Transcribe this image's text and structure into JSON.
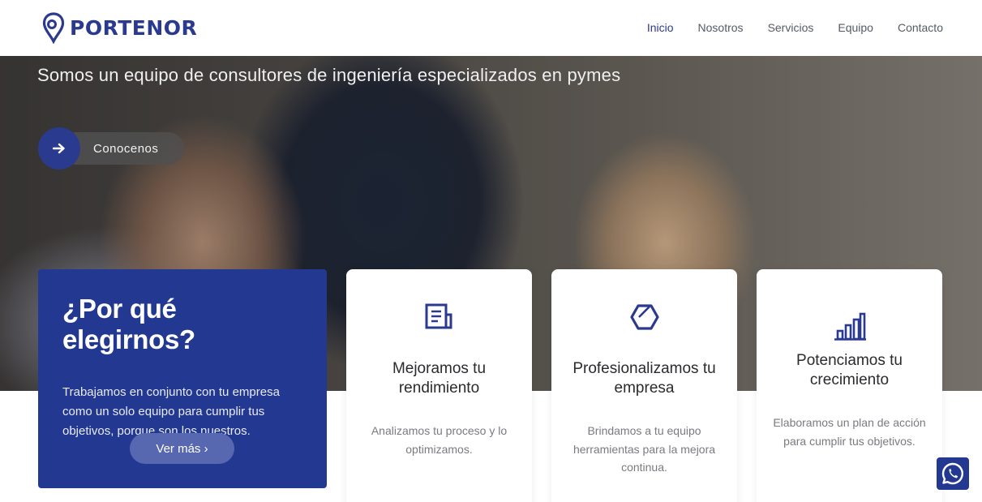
{
  "brand": {
    "name": "PORTENOR",
    "color": "#2a3a8f"
  },
  "nav": [
    {
      "label": "Inicio",
      "active": true
    },
    {
      "label": "Nosotros",
      "active": false
    },
    {
      "label": "Servicios",
      "active": false
    },
    {
      "label": "Equipo",
      "active": false
    },
    {
      "label": "Contacto",
      "active": false
    }
  ],
  "hero": {
    "tagline": "Somos un equipo de consultores de ingeniería especializados en pymes",
    "cta_label": "Conocenos",
    "cta_icon": "arrow-right-icon"
  },
  "why": {
    "title": "¿Por qué elegirnos?",
    "text": "Trabajamos en conjunto con tu empresa como un solo equipo para cumplir tus objetivos, porque son los nuestros.",
    "button_label": "Ver más ›",
    "color": "#233890"
  },
  "features": [
    {
      "icon": "document-icon",
      "title": "Mejoramos tu rendimiento",
      "text": "Analizamos tu proceso y lo optimizamos."
    },
    {
      "icon": "hexagon-icon",
      "title": "Profesionalizamos tu empresa",
      "text": "Brindamos a tu equipo herramientas para la mejora continua."
    },
    {
      "icon": "bar-chart-icon",
      "title": "Potenciamos tu crecimiento",
      "text": "Elaboramos un plan de acción para cumplir tus objetivos."
    }
  ],
  "whatsapp": {
    "icon": "whatsapp-icon"
  }
}
